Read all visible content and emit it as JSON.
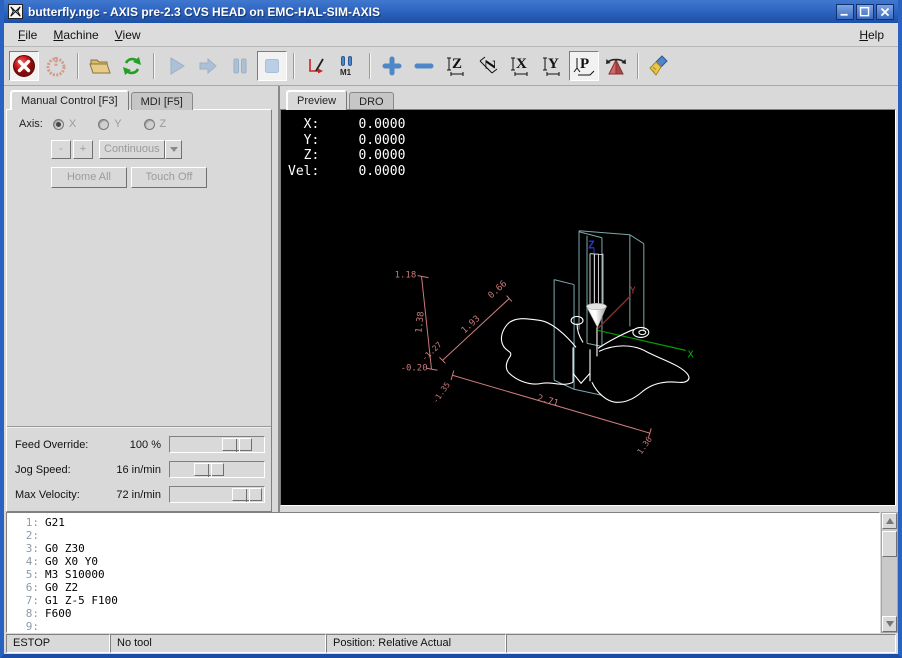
{
  "window": {
    "title": "butterfly.ngc - AXIS pre-2.3 CVS HEAD on EMC-HAL-SIM-AXIS"
  },
  "menu": {
    "items": [
      "File",
      "Machine",
      "View"
    ],
    "right_item": "Help"
  },
  "toolbar": {
    "m1_label": "M1",
    "views": {
      "top": "Z",
      "rot_top": "Z",
      "side": "X",
      "front": "Y",
      "persp": "P"
    }
  },
  "left_panel": {
    "tabs": {
      "manual": "Manual Control [F3]",
      "mdi": "MDI [F5]"
    },
    "axis_label": "Axis:",
    "axis_options": [
      "X",
      "Y",
      "Z"
    ],
    "jog_minus": "-",
    "jog_plus": "+",
    "jog_mode": "Continuous",
    "home_all": "Home All",
    "touch_off": "Touch Off",
    "sliders": [
      {
        "label": "Feed Override:",
        "value": "100 %",
        "pos": 55
      },
      {
        "label": "Jog Speed:",
        "value": "16 in/min",
        "pos": 25
      },
      {
        "label": "Max Velocity:",
        "value": "72 in/min",
        "pos": 66
      }
    ]
  },
  "preview": {
    "tabs": {
      "preview": "Preview",
      "dro": "DRO"
    },
    "dro_lines": [
      "  X:     0.0000",
      "  Y:     0.0000",
      "  Z:     0.0000",
      "Vel:     0.0000"
    ],
    "axes": {
      "x": "X",
      "y": "Y",
      "z": "Z"
    },
    "dimensions": {
      "z_max": "1.18",
      "z_size": "1.38",
      "z_min": "-0.20",
      "y_max": "0.66",
      "y_size": "1.93",
      "y_min": "-1.27",
      "x_size": "2.71",
      "x_min": "-1.35",
      "x_max": "1.36"
    }
  },
  "gcode": {
    "lines": [
      {
        "n": "1:",
        "c": "G21"
      },
      {
        "n": "2:",
        "c": ""
      },
      {
        "n": "3:",
        "c": "G0 Z30"
      },
      {
        "n": "4:",
        "c": "G0 X0 Y0"
      },
      {
        "n": "5:",
        "c": "M3 S10000"
      },
      {
        "n": "6:",
        "c": "G0 Z2"
      },
      {
        "n": "7:",
        "c": "G1 Z-5 F100"
      },
      {
        "n": "8:",
        "c": "F600"
      },
      {
        "n": "9:",
        "c": ""
      }
    ]
  },
  "status": {
    "cells": [
      "ESTOP",
      "No tool",
      "Position: Relative Actual"
    ]
  },
  "colors": {
    "titlebar_blue": "#2b62be",
    "estop_red": "#c81414",
    "tool_blue": "#4e86c8",
    "dim_salmon": "#cc7a7a",
    "axis_x_green": "#00aa00",
    "axis_y_red": "#a63232",
    "axis_z_blue": "#2a35c8",
    "machine_limits_cyan": "#7fa8ac"
  }
}
